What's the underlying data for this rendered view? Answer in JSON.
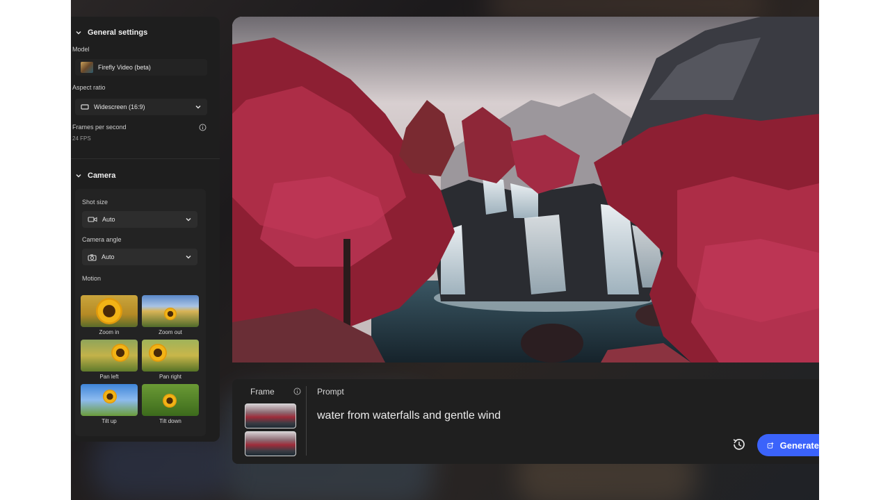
{
  "general_settings": {
    "heading": "General settings",
    "model_label": "Model",
    "model_value": "Firefly Video (beta)",
    "aspect_label": "Aspect ratio",
    "aspect_value": "Widescreen (16:9)",
    "fps_label": "Frames per second",
    "fps_value": "24 FPS"
  },
  "camera": {
    "heading": "Camera",
    "shot_size_label": "Shot size",
    "shot_size_value": "Auto",
    "camera_angle_label": "Camera angle",
    "camera_angle_value": "Auto",
    "motion_label": "Motion",
    "motion_options": [
      "Zoom in",
      "Zoom out",
      "Pan left",
      "Pan right",
      "Tilt up",
      "Tilt down"
    ]
  },
  "prompt_bar": {
    "frame_label": "Frame",
    "prompt_label": "Prompt",
    "prompt_text": "water from waterfalls and gentle wind",
    "generate_label": "Generate"
  },
  "colors": {
    "accent": "#3b63fb",
    "panel_bg": "#1e1e1e"
  },
  "icons": [
    "chevron-down-icon",
    "info-icon",
    "video-camera-icon",
    "camera-icon",
    "history-icon",
    "generate-sparkle-icon",
    "widescreen-icon"
  ]
}
